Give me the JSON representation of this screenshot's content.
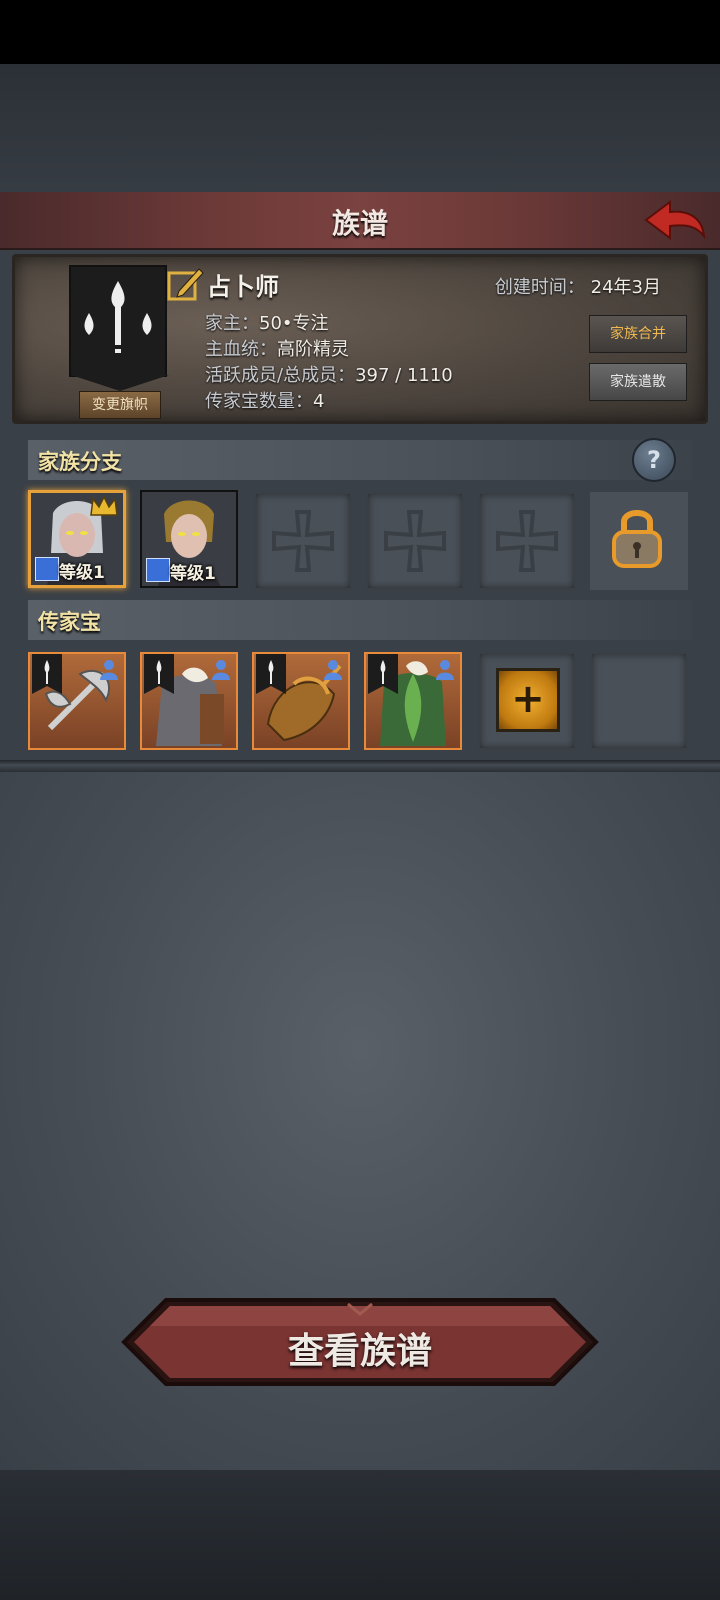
{
  "header": {
    "title": "族谱"
  },
  "family": {
    "banner_button": "变更旗帜",
    "name": "占卜师",
    "created_label": "创建时间：",
    "created_value": "24年3月",
    "leader_label": "家主：",
    "leader_value": "50•专注",
    "bloodline_label": "主血统：",
    "bloodline_value": "高阶精灵",
    "members_label": "活跃成员/总成员：",
    "members_value": "397 / 1110",
    "heirloom_count_label": "传家宝数量：",
    "heirloom_count_value": "4",
    "merge_button": "家族合并",
    "disband_button": "家族遣散"
  },
  "branches": {
    "title": "家族分支",
    "slots": [
      {
        "level": "等级1",
        "selected": true,
        "crown": true
      },
      {
        "level": "等级1",
        "selected": false,
        "crown": false
      }
    ]
  },
  "treasures": {
    "title": "传家宝",
    "add_symbol": "+"
  },
  "view_button": "查看族谱",
  "colors": {
    "accent_gold": "#f2e2a6",
    "highlight_orange": "#e6a13a",
    "header_red": "#7a4240"
  }
}
